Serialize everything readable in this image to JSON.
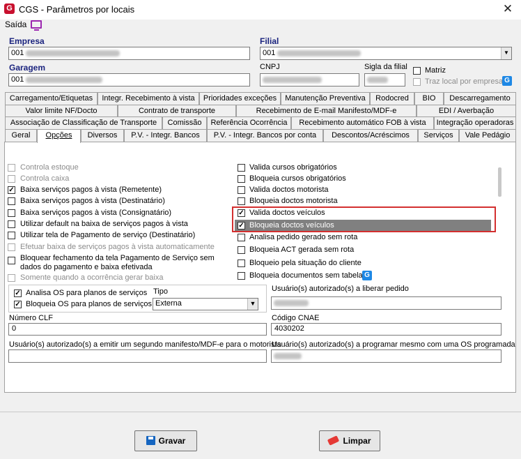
{
  "window": {
    "title": "CGS - Parâmetros por locais",
    "close": "✕"
  },
  "menu": {
    "saida": "Saída"
  },
  "header": {
    "empresa_label": "Empresa",
    "empresa_value": "001",
    "filial_label": "Filial",
    "filial_value": "001",
    "garagem_label": "Garagem",
    "garagem_value": "001",
    "cnpj_label": "CNPJ",
    "sigla_label": "Sigla da filial",
    "matriz_label": "Matriz",
    "traz_local_label": "Traz local por empresa"
  },
  "tabs": {
    "row1": [
      "Carregamento/Etiquetas",
      "Integr. Recebimento à vista",
      "Prioridades exceções",
      "Manutenção Preventiva",
      "Rodocred",
      "BIO",
      "Descarregamento"
    ],
    "row2": [
      "Valor limite NF/Docto",
      "Contrato de transporte",
      "Recebimento de E-mail Manifesto/MDF-e",
      "EDI / Averbação"
    ],
    "row3": [
      "Associação de Classificação de Transporte",
      "Comissão",
      "Referência Ocorrência",
      "Recebimento automático FOB à vista",
      "Integração operadoras"
    ],
    "row4": [
      "Geral",
      "Opções",
      "Diversos",
      "P.V. - Integr. Bancos",
      "P.V. - Integr. Bancos por conta",
      "Descontos/Acréscimos",
      "Serviços",
      "Vale Pedágio"
    ]
  },
  "options_left": [
    {
      "label": "Controla estoque",
      "checked": false,
      "disabled": true
    },
    {
      "label": "Controla caixa",
      "checked": false,
      "disabled": true
    },
    {
      "label": "Baixa serviços pagos à vista (Remetente)",
      "checked": true,
      "disabled": false
    },
    {
      "label": "Baixa serviços pagos à vista (Destinatário)",
      "checked": false,
      "disabled": false
    },
    {
      "label": "Baixa serviços pagos à vista (Consignatário)",
      "checked": false,
      "disabled": false
    },
    {
      "label": "Utilizar default na baixa de serviços pagos à vista",
      "checked": false,
      "disabled": false
    },
    {
      "label": "Utilizar tela de Pagamento de serviço (Destinatário)",
      "checked": false,
      "disabled": false
    },
    {
      "label": "Efetuar baixa de serviços pagos à vista automaticamente",
      "checked": false,
      "disabled": true
    },
    {
      "label": "Bloquear fechamento da tela Pagamento de Serviço sem",
      "label2": "dados do pagamento e baixa efetivada",
      "checked": false,
      "disabled": false
    },
    {
      "label": "Somente quando a ocorrência gerar baixa",
      "checked": false,
      "disabled": true
    }
  ],
  "options_right": [
    {
      "label": "Valida cursos obrigatórios",
      "checked": false
    },
    {
      "label": "Bloqueia cursos obrigatórios",
      "checked": false
    },
    {
      "label": "Valida doctos motorista",
      "checked": false
    },
    {
      "label": "Bloqueia doctos motorista",
      "checked": false
    },
    {
      "label": "Valida doctos veículos",
      "checked": true
    },
    {
      "label": "Bloqueia doctos veículos",
      "checked": true
    },
    {
      "label": "Analisa pedido gerado sem rota",
      "checked": false
    },
    {
      "label": "Bloqueia ACT gerada sem rota",
      "checked": false
    },
    {
      "label": "Bloqueio pela situação do cliente",
      "checked": false
    },
    {
      "label": "Bloqueia documentos sem tabela",
      "checked": false
    }
  ],
  "os": {
    "analisa_label": "Analisa OS para planos de serviços",
    "bloqueia_label": "Bloqueia OS para planos de serviços",
    "tipo_label": "Tipo",
    "tipo_value": "Externa"
  },
  "fields": {
    "usuarios_liberar_label": "Usuário(s) autorizado(s) a liberar pedido",
    "numero_clf_label": "Número CLF",
    "numero_clf_value": "0",
    "codigo_cnae_label": "Código CNAE",
    "codigo_cnae_value": "4030202",
    "usuarios_manifesto_label": "Usuário(s) autorizado(s) a emitir um segundo manifesto/MDF-e para o motorista",
    "usuarios_programar_label": "Usuário(s) autorizado(s) a programar mesmo com uma OS programada"
  },
  "buttons": {
    "gravar": "Gravar",
    "limpar": "Limpar"
  },
  "colors": {
    "highlight": "#808080",
    "red_box": "#d32f2f",
    "label_blue": "#1a237e"
  }
}
